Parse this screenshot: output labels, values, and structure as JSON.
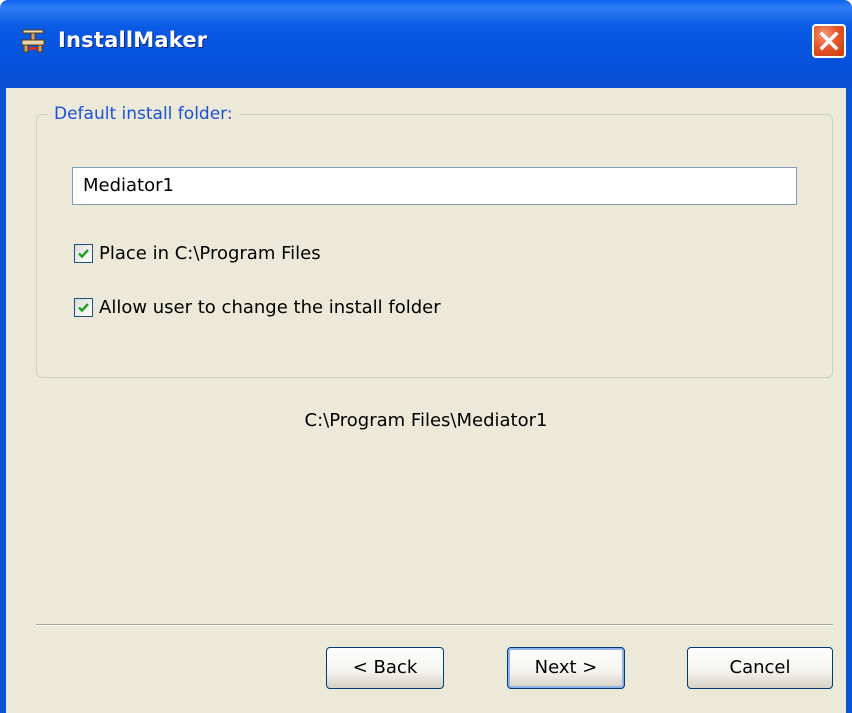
{
  "window": {
    "title": "InstallMaker",
    "icon": "installmaker-app-icon",
    "close_icon": "close-icon"
  },
  "group": {
    "legend": "Default install folder:",
    "folder_value": "Mediator1",
    "place_in_program_files": {
      "label": "Place in C:\\Program Files",
      "checked": true
    },
    "allow_user_change": {
      "label": "Allow user to change the install folder",
      "checked": true
    }
  },
  "resolved_path": "C:\\Program Files\\Mediator1",
  "buttons": {
    "back": "< Back",
    "next": "Next >",
    "cancel": "Cancel"
  },
  "colors": {
    "titlebar": "#0a55d8",
    "client_bg": "#ece9d8",
    "legend": "#1c4fd8",
    "close": "#e5572b"
  }
}
